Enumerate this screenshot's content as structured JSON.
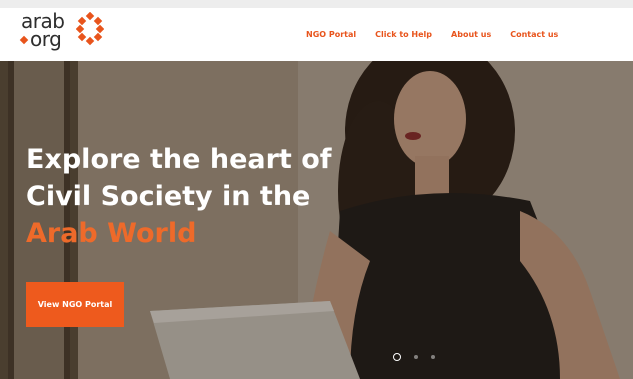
{
  "header": {
    "logo": {
      "line1": "arab",
      "line2": "org"
    },
    "nav": [
      {
        "label": "NGO Portal"
      },
      {
        "label": "Click to Help"
      },
      {
        "label": "About us"
      },
      {
        "label": "Contact us"
      }
    ]
  },
  "hero": {
    "title_line1": "Explore the heart of",
    "title_line2": "Civil Society in the",
    "title_line3": "Arab World",
    "cta_label": "View NGO Portal",
    "carousel": {
      "slides": 3,
      "active": 1
    }
  },
  "colors": {
    "accent": "#e8541c",
    "button": "#ee5a1d",
    "header_bg": "#ffffff",
    "hero_text": "#ffffff"
  }
}
